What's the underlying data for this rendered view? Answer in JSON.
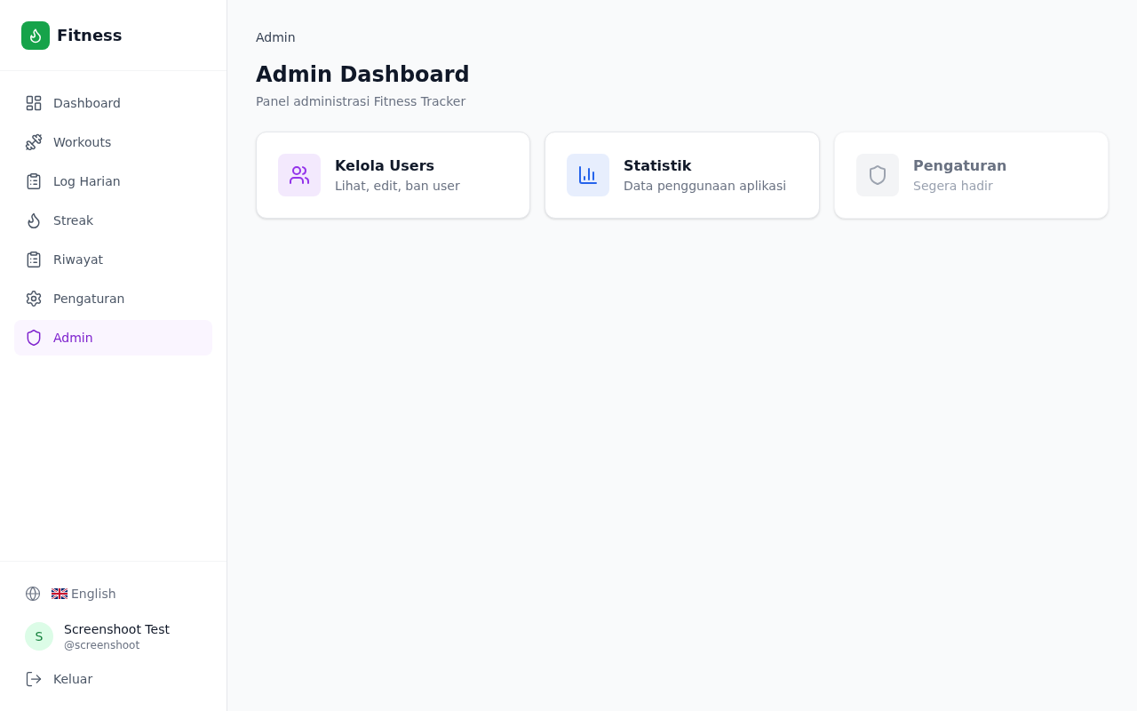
{
  "sidebar": {
    "brand": "Fitness",
    "nav": [
      {
        "label": "Dashboard",
        "selected": false
      },
      {
        "label": "Workouts",
        "selected": false
      },
      {
        "label": "Log Harian",
        "selected": false
      },
      {
        "label": "Streak",
        "selected": false
      },
      {
        "label": "Riwayat",
        "selected": false
      },
      {
        "label": "Pengaturan",
        "selected": false
      },
      {
        "label": "Admin",
        "selected": true
      }
    ],
    "language": "English",
    "user": {
      "initial": "S",
      "name": "Screenshoot Test",
      "username": "@screenshoot"
    },
    "logout": "Keluar"
  },
  "main": {
    "breadcrumb": "Admin",
    "title": "Admin Dashboard",
    "subtitle": "Panel administrasi Fitness Tracker",
    "cards": [
      {
        "title": "Kelola Users",
        "description": "Lihat, edit, ban user",
        "color": "#9333ea",
        "disabled": false
      },
      {
        "title": "Statistik",
        "description": "Data penggunaan aplikasi",
        "color": "#2563eb",
        "disabled": false
      },
      {
        "title": "Pengaturan",
        "description": "Segera hadir",
        "disabled": true
      }
    ]
  }
}
